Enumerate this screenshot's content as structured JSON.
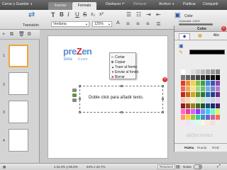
{
  "menubar": {
    "file_menu": "Cerrar y Guardar",
    "tabs": [
      {
        "label": "Insertar",
        "active": false
      },
      {
        "label": "Formato",
        "active": true
      }
    ],
    "undo": "Deshacer",
    "redo": "Rehacer",
    "files": "Archivo",
    "publish": "Publicar",
    "share": "Compartir"
  },
  "toolbar": {
    "transition_label": "Transición",
    "font_family": "Verdana",
    "zoom": "125%",
    "color_label": "Color",
    "opacity_label": "Opacidad: 100%",
    "opacity_value": 1.0
  },
  "slides": [
    {
      "number": "1",
      "current": true
    },
    {
      "number": "2",
      "current": false
    },
    {
      "number": "3",
      "current": false
    },
    {
      "number": "4",
      "current": false
    }
  ],
  "slide": {
    "logo_text": "preZentit",
    "logo_prefix": "pre",
    "logo_z": "Z",
    "logo_suffix": "en",
    "logo_beta": "beta",
    "logo_it": "it.com",
    "textbox_text": "Doble click para añadir texto."
  },
  "context_menu": {
    "items": [
      {
        "label": "Cortar",
        "icon": "scissors-icon",
        "danger": false
      },
      {
        "label": "Copiar",
        "icon": "copy-icon",
        "danger": false
      },
      {
        "label": "Traer al frente",
        "icon": "bring-front-icon",
        "danger": false
      },
      {
        "label": "Enviar al fondo",
        "icon": "send-back-icon",
        "danger": false
      },
      {
        "label": "Borrar",
        "icon": "delete-icon",
        "danger": true
      }
    ]
  },
  "color_panel": {
    "title": "Color",
    "tab_abc": "Abc",
    "watermark": "Opciones",
    "bottom_tabs": [
      {
        "label": "Paleta",
        "active": true
      },
      {
        "label": "Rueda",
        "active": false
      },
      {
        "label": "RGB",
        "active": false
      }
    ],
    "selected_color": "#000000",
    "palette": [
      [
        "#ffffff",
        "#eeeeee",
        "#dddddd",
        "#cccccc",
        "#bbbbbb",
        "#aaaaaa",
        "#999999",
        "#888888"
      ],
      [
        "#777777",
        "#666666",
        "#555555",
        "#444444",
        "#333333",
        "#222222",
        "#111111",
        "#000000"
      ],
      [
        "#e23b2a",
        "#f08c28",
        "#f7d23a",
        "#7fc23f",
        "#37a34a",
        "#3c8ad8",
        "#3a55b8",
        "#8e44b5"
      ],
      [
        "#f06a5c",
        "#f5a95b",
        "#fae27a",
        "#a6d77a",
        "#6fc07e",
        "#78afe5",
        "#7489d0",
        "#b27fcf"
      ],
      [
        "#c1271b",
        "#c7661a",
        "#d1a91f",
        "#5c9a2c",
        "#267a35",
        "#2a6aaa",
        "#253f8f",
        "#6a2c8e"
      ],
      [
        "#f9c0b8",
        "#fbd6b0",
        "#fdf0c0",
        "#d6ecc4",
        "#c2e5c9",
        "#c6dff5",
        "#c8d1ee",
        "#e3cdee"
      ],
      [
        "#8f1c13",
        "#934c13",
        "#9c7e17",
        "#426e20",
        "#1b5626",
        "#1d4c7c",
        "#1a2d66",
        "#4c1f66"
      ],
      [
        "#ff66cc",
        "#ff3399",
        "#cc66ff",
        "#9933ff",
        "#6699ff",
        "#33ccff",
        "#66ffcc",
        "#ccff66"
      ],
      [
        "#ff9966",
        "#ffcc33",
        "#99cc33",
        "#33cc99",
        "#3399cc",
        "#6666cc",
        "#cc6699",
        "#ff6666"
      ],
      [
        "#fde3ec",
        "#e9e3fb",
        "#dff1fb",
        "#e2f9ec",
        "#f8f7dd",
        "#fbe9db",
        "#f4dede",
        "#eeeeee"
      ]
    ]
  },
  "statusbar": {
    "coords": "x:16,3% y:35,5%",
    "size": "54% x 22,7%",
    "summary": "Resumen",
    "notes": "Notas"
  }
}
